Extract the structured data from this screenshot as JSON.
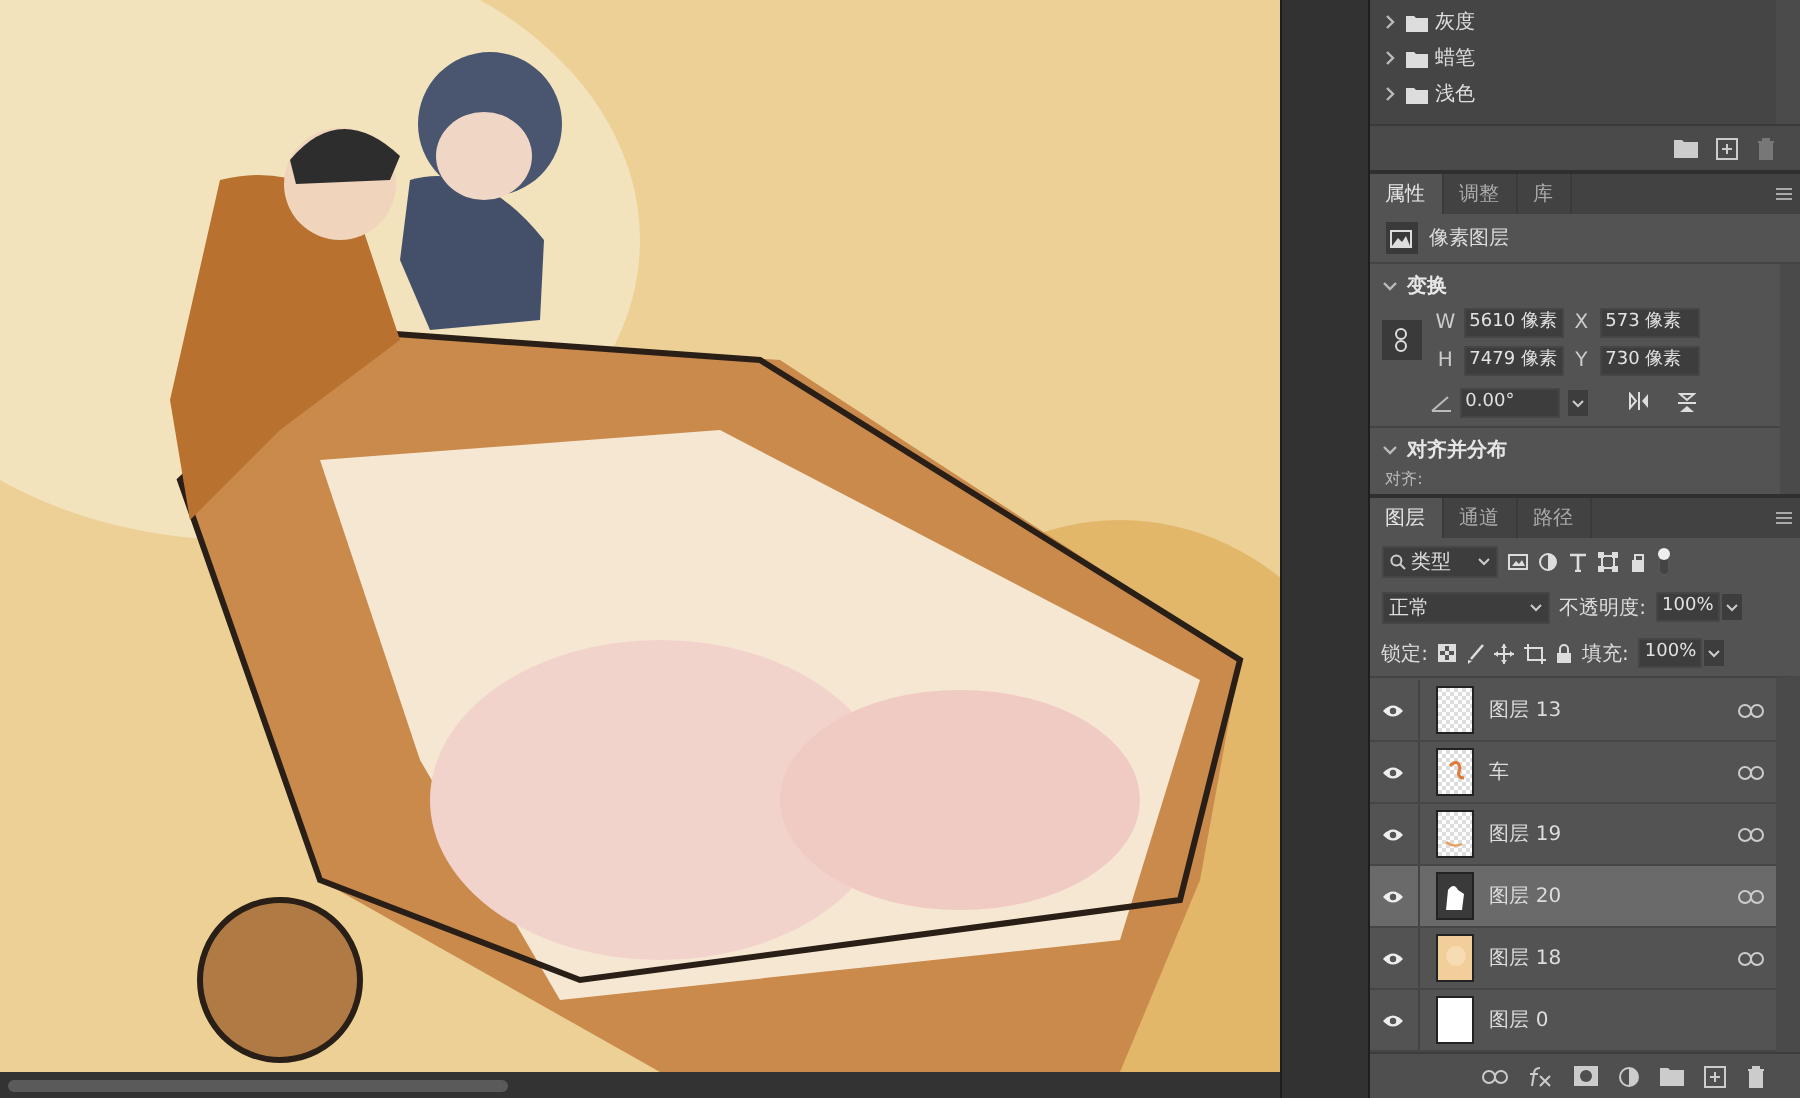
{
  "swatch_groups": [
    {
      "label": "灰度",
      "expanded": false
    },
    {
      "label": "蜡笔",
      "expanded": false
    },
    {
      "label": "浅色",
      "expanded": false
    }
  ],
  "properties": {
    "tabs": [
      {
        "label": "属性",
        "selected": true
      },
      {
        "label": "调整",
        "selected": false
      },
      {
        "label": "库",
        "selected": false
      }
    ],
    "layer_kind": "像素图层",
    "transform": {
      "title": "变换",
      "expanded": true,
      "w_label": "W",
      "w": "5610 像素",
      "x_label": "X",
      "x": "573 像素",
      "h_label": "H",
      "h": "7479 像素",
      "y_label": "Y",
      "y": "730 像素",
      "angle": "0.00°"
    },
    "align": {
      "title": "对齐并分布",
      "expanded": true,
      "label": "对齐:"
    }
  },
  "layers_panel": {
    "tabs": [
      {
        "label": "图层",
        "selected": true
      },
      {
        "label": "通道",
        "selected": false
      },
      {
        "label": "路径",
        "selected": false
      }
    ],
    "filter": "类型",
    "blend_mode": "正常",
    "opacity_label": "不透明度:",
    "opacity": "100%",
    "lock_label": "锁定:",
    "fill_label": "填充:",
    "fill": "100%",
    "layers": [
      {
        "name": "图层 13",
        "visible": true,
        "selected": false,
        "linked": true,
        "kind": "empty"
      },
      {
        "name": "车",
        "visible": true,
        "selected": false,
        "linked": true,
        "kind": "sketch"
      },
      {
        "name": "图层 19",
        "visible": true,
        "selected": false,
        "linked": true,
        "kind": "stroke"
      },
      {
        "name": "图层 20",
        "visible": true,
        "selected": true,
        "linked": true,
        "kind": "mask"
      },
      {
        "name": "图层 18",
        "visible": true,
        "selected": false,
        "linked": true,
        "kind": "paper"
      },
      {
        "name": "图层 0",
        "visible": true,
        "selected": false,
        "linked": false,
        "kind": "white"
      }
    ]
  }
}
